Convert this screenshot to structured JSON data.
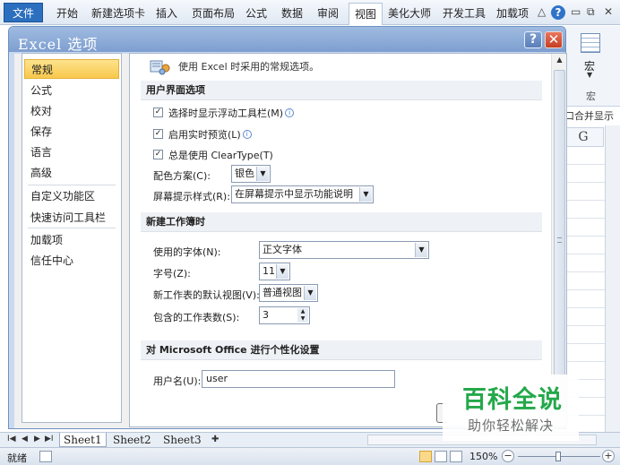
{
  "ribbon": {
    "file_tab": "文件",
    "tabs": [
      "开始",
      "新建选项卡",
      "插入",
      "页面布局",
      "公式",
      "数据",
      "审阅",
      "视图",
      "美化大师",
      "开发工具",
      "加载项"
    ],
    "active_tab": "视图",
    "macro_label": "宏",
    "macro_group": "宏",
    "merge_label": "口合并显示",
    "column_header": "G"
  },
  "dialog": {
    "title": "Excel 选项",
    "help_label": "?",
    "close_label": "✕",
    "nav": [
      "常规",
      "公式",
      "校对",
      "保存",
      "语言",
      "高级",
      "自定义功能区",
      "快速访问工具栏",
      "加载项",
      "信任中心"
    ],
    "nav_selected": "常规",
    "intro_text": "使用 Excel 时采用的常规选项。",
    "section_ui": "用户界面选项",
    "checkbox_1": "选择时显示浮动工具栏(M)",
    "checkbox_2": "启用实时预览(L)",
    "checkbox_3": "总是使用 ClearType(T)",
    "color_scheme_label": "配色方案(C):",
    "color_scheme_value": "银色",
    "screentip_label": "屏幕提示样式(R):",
    "screentip_value": "在屏幕提示中显示功能说明",
    "section_workbook": "新建工作簿时",
    "font_label": "使用的字体(N):",
    "font_value": "正文字体",
    "size_label": "字号(Z):",
    "size_value": "11",
    "view_label": "新工作表的默认视图(V):",
    "view_value": "普通视图",
    "sheets_label": "包含的工作表数(S):",
    "sheets_value": "3",
    "section_personal": "对 Microsoft Office 进行个性化设置",
    "username_label": "用户名(U):",
    "username_value": "user"
  },
  "sheets": {
    "tabs": [
      "Sheet1",
      "Sheet2",
      "Sheet3"
    ],
    "status_ready": "就绪",
    "zoom": "150%"
  },
  "watermark": {
    "title": "百科全说",
    "subtitle": "助你轻松解决"
  }
}
